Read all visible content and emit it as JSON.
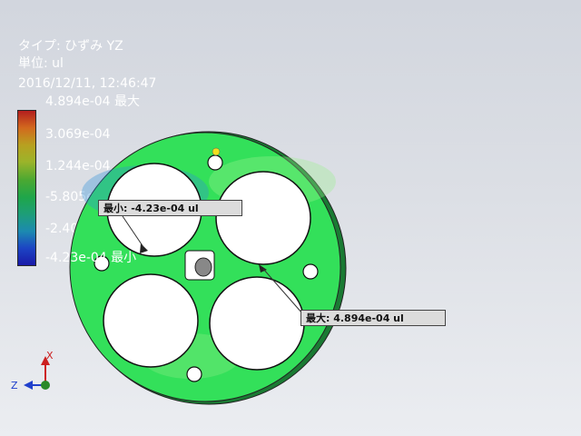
{
  "info": {
    "type_label": "タイプ: ひずみ YZ",
    "unit_label": "単位: ul",
    "timestamp": "2016/12/11, 12:46:47"
  },
  "legend": {
    "max_label": "4.894e-04 最大",
    "ticks": [
      "3.069e-04",
      "1.244e-04",
      "-5.805e-05",
      "-2.405e-04"
    ],
    "min_label": "-4.23e-04 最小",
    "colors": [
      "#b31e1e",
      "#d2691e",
      "#b8a020",
      "#9cb42a",
      "#4aa832",
      "#1fa64a",
      "#1d9e78",
      "#1c8ab0",
      "#1c44c4",
      "#1a1aa8"
    ]
  },
  "callouts": {
    "min": "最小: -4.23e-04 ul",
    "max": "最大: 4.894e-04 ul"
  },
  "axes": {
    "x_label": "X",
    "z_label": "Z",
    "x_color": "#cc2020",
    "z_color": "#2040cc",
    "origin_color": "#2a8a2a"
  },
  "model": {
    "fill_color": "#33e05a",
    "hole_fill_color": "#ffffff"
  }
}
